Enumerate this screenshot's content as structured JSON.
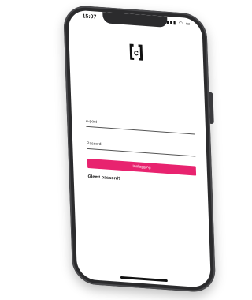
{
  "status_bar": {
    "time": "15:07",
    "icons": "▮▮▮ ◠ ▭"
  },
  "logo": {
    "letter": "c"
  },
  "form": {
    "email_placeholder": "e-post",
    "password_placeholder": "Passord",
    "login_label": "Innlogging",
    "forgot_label": "Glemt passord?"
  },
  "colors": {
    "accent": "#e8236f"
  }
}
